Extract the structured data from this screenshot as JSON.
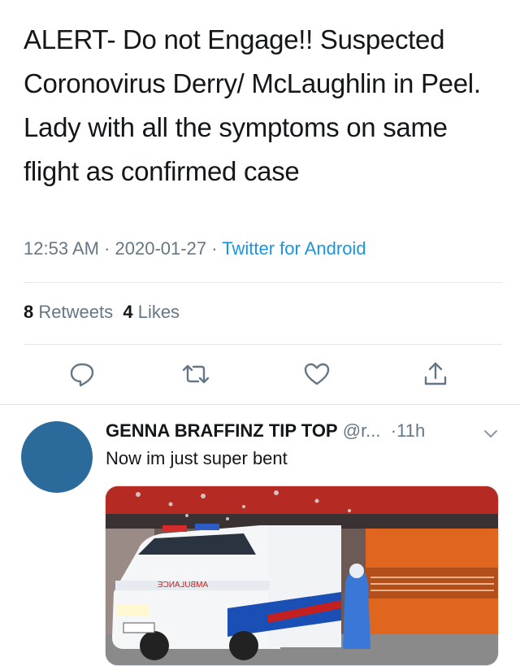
{
  "tweet": {
    "text": "ALERT- Do not Engage!!  Suspected Coronovirus Derry/ McLaughlin in Peel. Lady with all the symptoms on same flight as confirmed case",
    "time": "12:53 AM",
    "date": "2020-01-27",
    "source": "Twitter for Android",
    "retweets_count": "8",
    "retweets_label": "Retweets",
    "likes_count": "4",
    "likes_label": "Likes"
  },
  "actions": {
    "reply_icon": "reply-icon",
    "retweet_icon": "retweet-icon",
    "like_icon": "heart-icon",
    "share_icon": "share-icon"
  },
  "reply": {
    "name": "GENNA BRAFFINZ TIP TOP",
    "handle": "@r...",
    "time": "11h",
    "text": "Now im just super bent",
    "avatar_color": "#2a6b9c",
    "media_vehicle_text": "AMBULANCE"
  },
  "colors": {
    "link": "#1b95e0",
    "muted": "#657786",
    "text": "#14171a",
    "divider": "#e1e8ed"
  }
}
